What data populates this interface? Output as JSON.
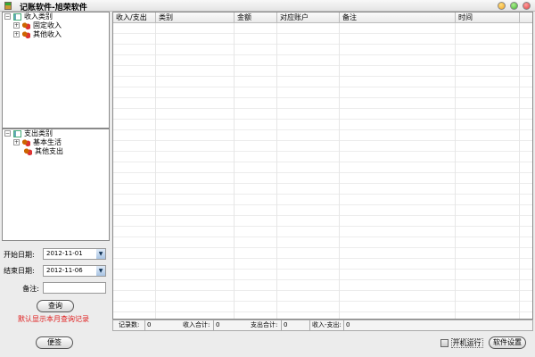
{
  "window": {
    "title": "记账软件-旭荣软件",
    "controls": [
      "minimize",
      "maximize",
      "close"
    ],
    "control_colors": [
      "#f0a020",
      "#3cb030",
      "#e04040"
    ]
  },
  "income_tree": {
    "root": "收入类别",
    "items": [
      "固定收入",
      "其他收入"
    ]
  },
  "expense_tree": {
    "root": "支出类别",
    "items": [
      "基本生活",
      "其他支出"
    ]
  },
  "filter": {
    "start_label": "开始日期:",
    "start_value": "2012-11-01",
    "end_label": "结束日期:",
    "end_value": "2012-11-06",
    "note_label": "备注:",
    "note_value": "",
    "query_button": "查询",
    "hint": "默认显示本月查询记录",
    "hint_color": "#e02020"
  },
  "table": {
    "columns": [
      "收入/支出",
      "类别",
      "金额",
      "对应账户",
      "备注",
      "时间"
    ],
    "rows": []
  },
  "status": {
    "count_label": "记录数:",
    "count": "0",
    "income_label": "收入合计:",
    "income": "0",
    "expense_label": "支出合计:",
    "expense": "0",
    "net_label": "收入-支出:",
    "net": "0"
  },
  "bottom": {
    "notes_button": "便签",
    "autostart_label": "开机运行",
    "autostart_checked": false,
    "settings_button": "软件设置"
  }
}
